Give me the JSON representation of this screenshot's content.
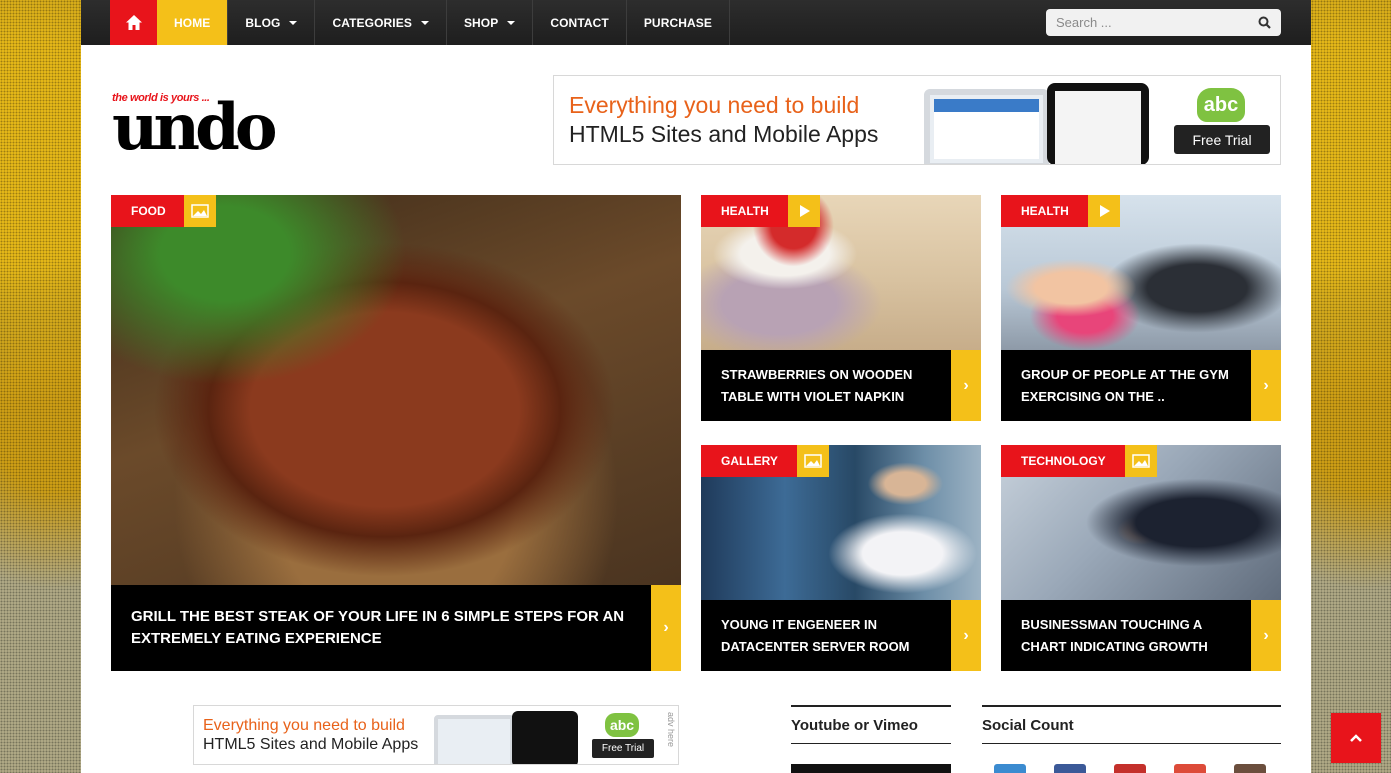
{
  "nav": {
    "items": [
      {
        "label": "Home",
        "active": true
      },
      {
        "label": "Blog",
        "dropdown": true
      },
      {
        "label": "Categories",
        "dropdown": true
      },
      {
        "label": "Shop",
        "dropdown": true
      },
      {
        "label": "Contact"
      },
      {
        "label": "Purchase"
      }
    ],
    "search_placeholder": "Search ..."
  },
  "header": {
    "tagline": "the world is yours ...",
    "logo": "undo"
  },
  "ad_banner": {
    "line1": "Everything you need to build",
    "line2": "HTML5 Sites and Mobile Apps",
    "badge": "abc",
    "cta": "Free Trial"
  },
  "ad_banner_small": {
    "line1": "Everything you need to build",
    "line2": "HTML5 Sites and Mobile Apps",
    "badge": "abc",
    "cta": "Free Trial",
    "side": "adv here"
  },
  "featured": [
    {
      "category": "Food",
      "icon": "gallery-icon",
      "title": "Grill the best steak of your life in 6 simple steps for an extremely eating experience"
    },
    {
      "category": "Health",
      "icon": "play-icon",
      "title": "Strawberries on wooden table with violet napkin"
    },
    {
      "category": "Health",
      "icon": "play-icon",
      "title": "Group of people at the gym exercising on the .."
    },
    {
      "category": "Gallery",
      "icon": "gallery-icon",
      "title": "Young IT engeneer in datacenter server room"
    },
    {
      "category": "Technology",
      "icon": "image-icon",
      "title": "Businessman touching a chart indicating growth"
    }
  ],
  "widgets": {
    "video_title": "Youtube or Vimeo",
    "social_title": "Social Count"
  },
  "colors": {
    "accent_red": "#e8141b",
    "accent_yellow": "#f4c019",
    "nav_bg": "#2d2d2d",
    "banner_orange": "#e8621a",
    "abc_green": "#7fc241"
  },
  "social_colors": [
    "#3b8bd0",
    "#3b5998",
    "#c4302b",
    "#dd4b39",
    "#6b4e3d"
  ]
}
